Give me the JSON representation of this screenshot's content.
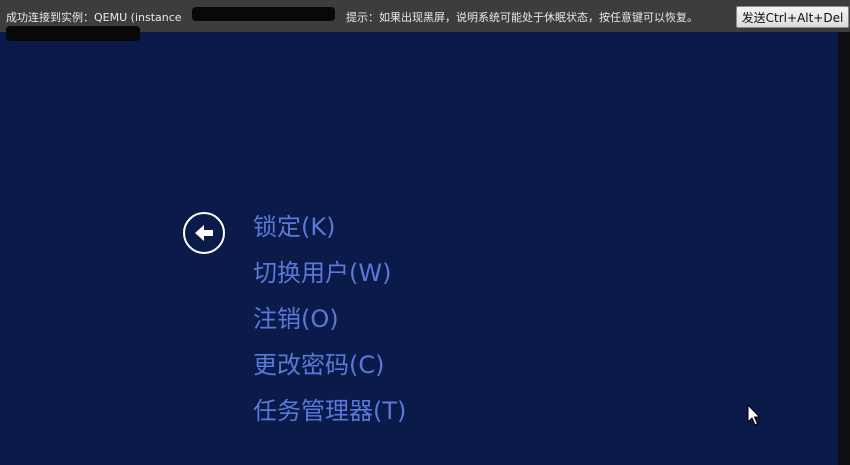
{
  "top_bar": {
    "status_prefix": "成功连接到实例：QEMU (instance",
    "hint": "提示：如果出现黑屏，说明系统可能处于休眠状态，按任意键可以恢复。",
    "send_cad_label": "发送Ctrl+Alt+Del"
  },
  "menu": {
    "items": [
      {
        "label": "锁定(K)"
      },
      {
        "label": "切换用户(W)"
      },
      {
        "label": "注销(O)"
      },
      {
        "label": "更改密码(C)"
      },
      {
        "label": "任务管理器(T)"
      }
    ]
  },
  "colors": {
    "background": "#0a1b4a",
    "menu_text": "#5a78d8",
    "top_bar": "#3d3d3d"
  },
  "icons": {
    "back": "back-arrow-icon",
    "cursor": "mouse-cursor-icon"
  }
}
